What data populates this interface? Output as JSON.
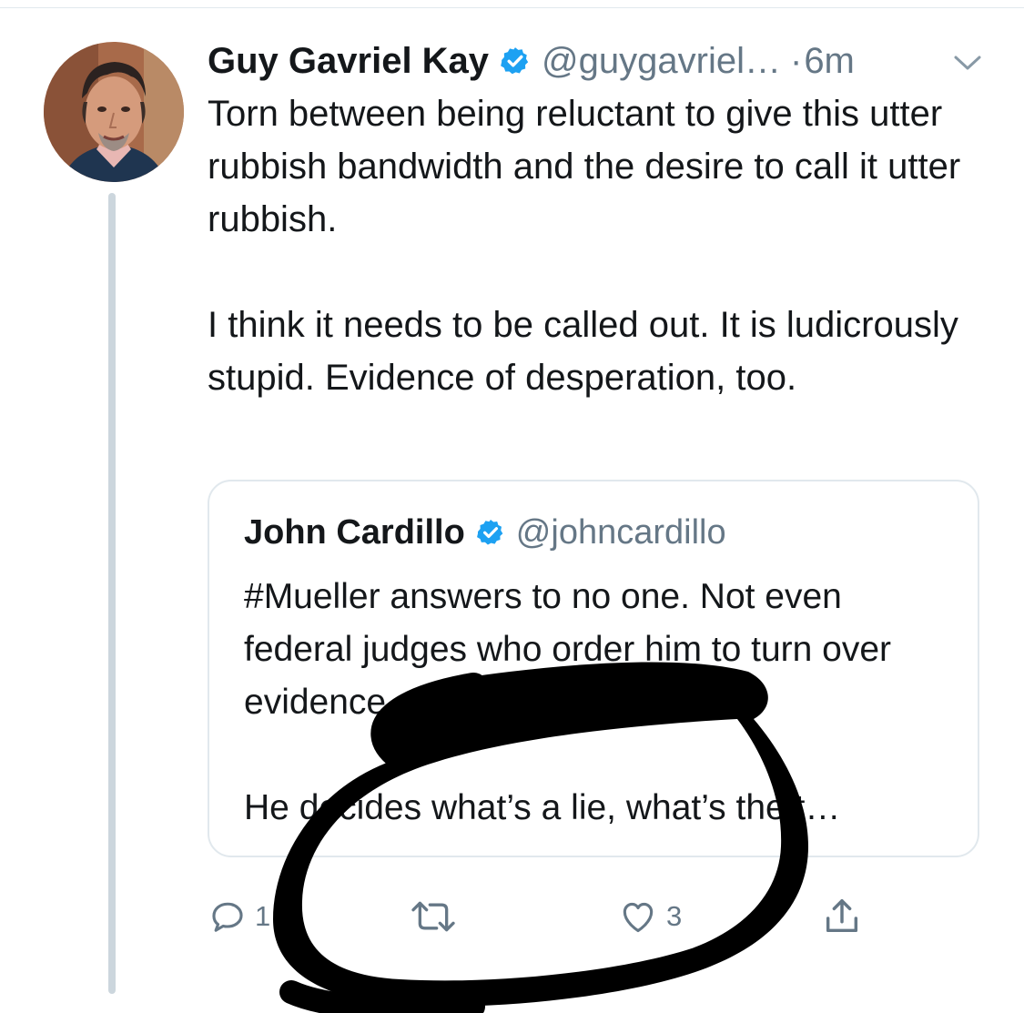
{
  "tweet": {
    "display_name": "Guy Gavriel Kay",
    "handle": "@guygavriel…",
    "separator": "·",
    "time": "6m",
    "paragraphs": [
      "Torn between being reluctant to give this utter rubbish bandwidth and the desire to call it utter rubbish.",
      "I think it needs to be called out. It is ludicrously stupid. Evidence of desperation, too."
    ]
  },
  "quoted_tweet": {
    "display_name": "John Cardillo",
    "handle": "@johncardillo",
    "paragraphs": [
      "#Mueller answers to no one. Not even federal judges who order him to turn over evidence.",
      "He decides what’s a lie, what’s the t…"
    ]
  },
  "actions": {
    "reply_count": "1",
    "like_count": "3"
  },
  "icons": {
    "verified": "verified-badge-icon",
    "caret": "chevron-down-icon",
    "reply": "reply-icon",
    "retweet": "retweet-icon",
    "like": "heart-icon",
    "share": "share-icon"
  },
  "colors": {
    "verified_blue": "#1da1f2",
    "text_primary": "#14171a",
    "text_secondary": "#657786",
    "border": "#e1e8ed",
    "thread_line": "#ccd6dd",
    "scribble": "#000000"
  }
}
